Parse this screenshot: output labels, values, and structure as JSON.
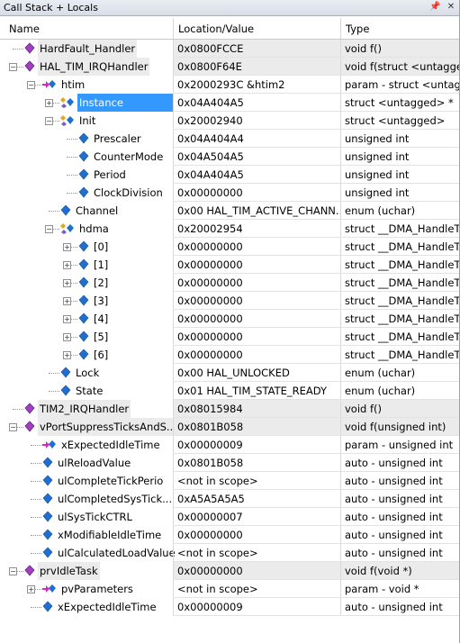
{
  "window": {
    "title": "Call Stack + Locals",
    "pin_icon": "pin-icon",
    "close_icon": "close-icon"
  },
  "columns": {
    "name": "Name",
    "value": "Location/Value",
    "type": "Type"
  },
  "rows": [
    {
      "name": "HardFault_Handler",
      "value": "0x0800FCCE",
      "type": "void f()",
      "level": 0,
      "icon": "function-icon",
      "expander": "none",
      "grey": true
    },
    {
      "name": "HAL_TIM_IRQHandler",
      "value": "0x0800F64E",
      "type": "void f(struct <untagged",
      "level": 0,
      "icon": "function-icon",
      "expander": "minus",
      "grey": true
    },
    {
      "name": "htim",
      "value": "0x2000293C &htim2",
      "type": "param - struct <untagge",
      "level": 1,
      "icon": "param-icon",
      "expander": "minus"
    },
    {
      "name": "Instance",
      "value": "0x04A404A5",
      "type": "struct <untagged> *",
      "level": 2,
      "icon": "struct-icon",
      "expander": "plus",
      "selected": true
    },
    {
      "name": "Init",
      "value": "0x20002940",
      "type": "struct <untagged>",
      "level": 2,
      "icon": "struct-icon",
      "expander": "minus"
    },
    {
      "name": "Prescaler",
      "value": "0x04A404A4",
      "type": "unsigned int",
      "level": 3,
      "icon": "variable-icon",
      "expander": "none"
    },
    {
      "name": "CounterMode",
      "value": "0x04A504A5",
      "type": "unsigned int",
      "level": 3,
      "icon": "variable-icon",
      "expander": "none"
    },
    {
      "name": "Period",
      "value": "0x04A404A5",
      "type": "unsigned int",
      "level": 3,
      "icon": "variable-icon",
      "expander": "none"
    },
    {
      "name": "ClockDivision",
      "value": "0x00000000",
      "type": "unsigned int",
      "level": 3,
      "icon": "variable-icon",
      "expander": "none"
    },
    {
      "name": "Channel",
      "value": "0x00 HAL_TIM_ACTIVE_CHANN...",
      "type": "enum (uchar)",
      "level": 2,
      "icon": "variable-icon",
      "expander": "none"
    },
    {
      "name": "hdma",
      "value": "0x20002954",
      "type": "struct __DMA_HandleTy",
      "level": 2,
      "icon": "struct-icon",
      "expander": "minus"
    },
    {
      "name": "[0]",
      "value": "0x00000000",
      "type": "struct __DMA_HandleTy",
      "level": 3,
      "icon": "variable-icon",
      "expander": "plus"
    },
    {
      "name": "[1]",
      "value": "0x00000000",
      "type": "struct __DMA_HandleTy",
      "level": 3,
      "icon": "variable-icon",
      "expander": "plus"
    },
    {
      "name": "[2]",
      "value": "0x00000000",
      "type": "struct __DMA_HandleTy",
      "level": 3,
      "icon": "variable-icon",
      "expander": "plus"
    },
    {
      "name": "[3]",
      "value": "0x00000000",
      "type": "struct __DMA_HandleTy",
      "level": 3,
      "icon": "variable-icon",
      "expander": "plus"
    },
    {
      "name": "[4]",
      "value": "0x00000000",
      "type": "struct __DMA_HandleTy",
      "level": 3,
      "icon": "variable-icon",
      "expander": "plus"
    },
    {
      "name": "[5]",
      "value": "0x00000000",
      "type": "struct __DMA_HandleTy",
      "level": 3,
      "icon": "variable-icon",
      "expander": "plus"
    },
    {
      "name": "[6]",
      "value": "0x00000000",
      "type": "struct __DMA_HandleTy",
      "level": 3,
      "icon": "variable-icon",
      "expander": "plus"
    },
    {
      "name": "Lock",
      "value": "0x00 HAL_UNLOCKED",
      "type": "enum (uchar)",
      "level": 2,
      "icon": "variable-icon",
      "expander": "none"
    },
    {
      "name": "State",
      "value": "0x01 HAL_TIM_STATE_READY",
      "type": "enum (uchar)",
      "level": 2,
      "icon": "variable-icon",
      "expander": "none"
    },
    {
      "name": "TIM2_IRQHandler",
      "value": "0x08015984",
      "type": "void f()",
      "level": 0,
      "icon": "function-icon",
      "expander": "none",
      "grey": true
    },
    {
      "name": "vPortSuppressTicksAndS...",
      "value": "0x0801B058",
      "type": "void f(unsigned int)",
      "level": 0,
      "icon": "function-icon",
      "expander": "minus",
      "grey": true
    },
    {
      "name": "xExpectedIdleTime",
      "value": "0x00000009",
      "type": "param - unsigned int",
      "level": 1,
      "icon": "param-icon",
      "expander": "none"
    },
    {
      "name": "ulReloadValue",
      "value": "0x0801B058",
      "type": "auto - unsigned int",
      "level": 1,
      "icon": "variable-icon",
      "expander": "none"
    },
    {
      "name": "ulCompleteTickPerio",
      "value": "<not in scope>",
      "type": "auto - unsigned int",
      "level": 1,
      "icon": "variable-icon",
      "expander": "none"
    },
    {
      "name": "ulCompletedSysTick...",
      "value": "0xA5A5A5A5",
      "type": "auto - unsigned int",
      "level": 1,
      "icon": "variable-icon",
      "expander": "none"
    },
    {
      "name": "ulSysTickCTRL",
      "value": "0x00000007",
      "type": "auto - unsigned int",
      "level": 1,
      "icon": "variable-icon",
      "expander": "none"
    },
    {
      "name": "xModifiableIdleTime",
      "value": "0x00000000",
      "type": "auto - unsigned int",
      "level": 1,
      "icon": "variable-icon",
      "expander": "none"
    },
    {
      "name": "ulCalculatedLoadValue",
      "value": "<not in scope>",
      "type": "auto - unsigned int",
      "level": 1,
      "icon": "variable-icon",
      "expander": "none"
    },
    {
      "name": "prvIdleTask",
      "value": "0x00000000",
      "type": "void f(void *)",
      "level": 0,
      "icon": "function-icon",
      "expander": "minus",
      "grey": true
    },
    {
      "name": "pvParameters",
      "value": "<not in scope>",
      "type": "param - void *",
      "level": 1,
      "icon": "param-icon",
      "expander": "plus"
    },
    {
      "name": "xExpectedIdleTime",
      "value": "0x00000009",
      "type": "auto - unsigned int",
      "level": 1,
      "icon": "variable-icon",
      "expander": "none"
    }
  ],
  "colors": {
    "selection": "#3399ff",
    "function_icon": "#a040c0",
    "variable_icon": "#1f6fd1",
    "param_arrow": "#e01fd0"
  }
}
